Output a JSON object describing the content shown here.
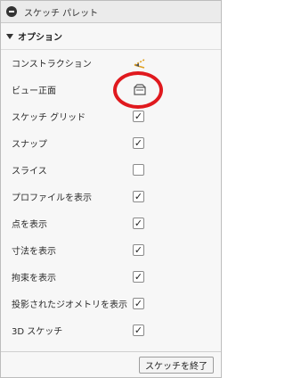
{
  "palette": {
    "title": "スケッチ パレット",
    "section_title": "オプション",
    "rows": [
      {
        "label": "コンストラクション",
        "control": "icon",
        "icon": "construction-pencil-icon"
      },
      {
        "label": "ビュー正面",
        "control": "icon",
        "icon": "look-at-icon"
      },
      {
        "label": "スケッチ グリッド",
        "control": "checkbox",
        "checked": true
      },
      {
        "label": "スナップ",
        "control": "checkbox",
        "checked": true
      },
      {
        "label": "スライス",
        "control": "checkbox",
        "checked": false
      },
      {
        "label": "プロファイルを表示",
        "control": "checkbox",
        "checked": true
      },
      {
        "label": "点を表示",
        "control": "checkbox",
        "checked": true
      },
      {
        "label": "寸法を表示",
        "control": "checkbox",
        "checked": true
      },
      {
        "label": "拘束を表示",
        "control": "checkbox",
        "checked": true
      },
      {
        "label": "投影されたジオメトリを表示",
        "control": "checkbox",
        "checked": true
      },
      {
        "label": "3D スケッチ",
        "control": "checkbox",
        "checked": true
      }
    ],
    "finish_button": "スケッチを終了"
  },
  "colors": {
    "annotation_circle": "#e0191e",
    "construction_icon": "#e0a020"
  }
}
